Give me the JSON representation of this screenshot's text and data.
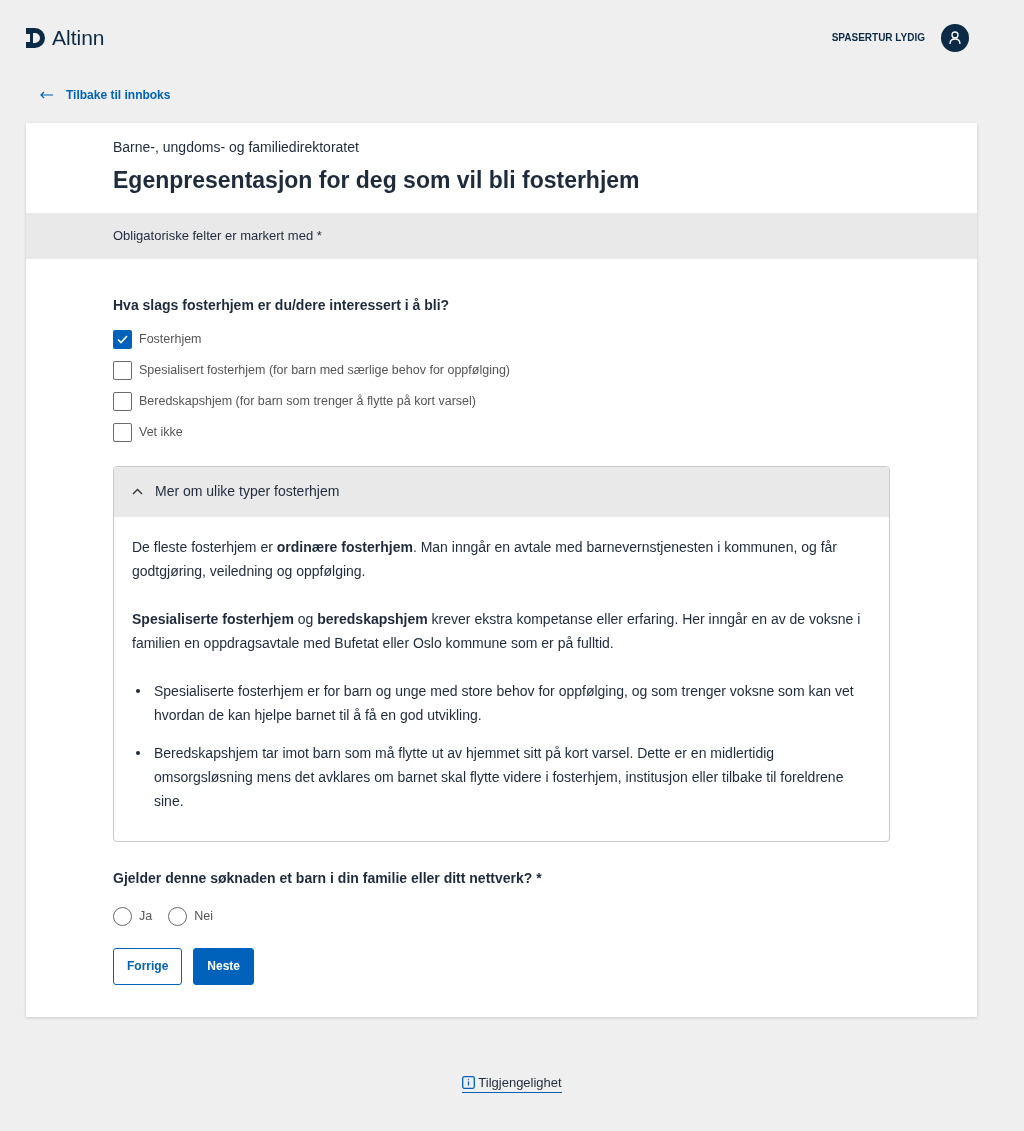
{
  "header": {
    "logo": "Altinn",
    "user_name": "SPASERTUR LYDIG"
  },
  "back_link": "Tilbake til innboks",
  "form": {
    "organization": "Barne-, ungdoms- og familiedirektoratet",
    "title": "Egenpresentasjon for deg som vil bli fosterhjem",
    "required_note": "Obligatoriske felter er markert med *",
    "question_1": {
      "label": "Hva slags fosterhjem er du/dere interessert i å bli?",
      "options": [
        {
          "label": "Fosterhjem",
          "checked": true
        },
        {
          "label": "Spesialisert fosterhjem (for barn med særlige behov for oppfølging)",
          "checked": false
        },
        {
          "label": "Beredskapshjem (for barn som trenger å flytte på kort varsel)",
          "checked": false
        },
        {
          "label": "Vet ikke",
          "checked": false
        }
      ]
    },
    "accordion": {
      "title": "Mer om ulike typer fosterhjem",
      "expanded": true,
      "paragraphs": [
        "De fleste fosterhjem er **ordinære fosterhjem**. Man inngår en avtale med barnevernstjenesten i kommunen, og får godtgjøring, veiledning og oppfølging.",
        "**Spesialiserte fosterhjem** og **beredskapshjem** krever ekstra kompetanse eller erfaring. Her inngår en av de voksne i familien en oppdragsavtale med Bufetat eller Oslo kommune som er på fulltid."
      ],
      "bullets": [
        "Spesialiserte fosterhjem er for barn og unge med store behov for oppfølging, og som trenger voksne som kan vet hvordan de kan hjelpe barnet til å få en god utvikling.",
        "Beredskapshjem tar imot barn som må flytte ut av hjemmet sitt på kort varsel. Dette er en midlertidig omsorgsløsning mens det avklares om barnet skal flytte videre i fosterhjem, institusjon eller tilbake til foreldrene sine."
      ]
    },
    "question_2": {
      "label": "Gjelder denne søknaden et barn i din familie eller ditt nettverk? *",
      "options": [
        {
          "label": "Ja",
          "selected": false
        },
        {
          "label": "Nei",
          "selected": false
        }
      ]
    },
    "buttons": [
      {
        "label": "Forrige",
        "kind": "secondary"
      },
      {
        "label": "Neste",
        "kind": "primary"
      }
    ]
  },
  "footer": {
    "link": "Tilgjengelighet"
  }
}
